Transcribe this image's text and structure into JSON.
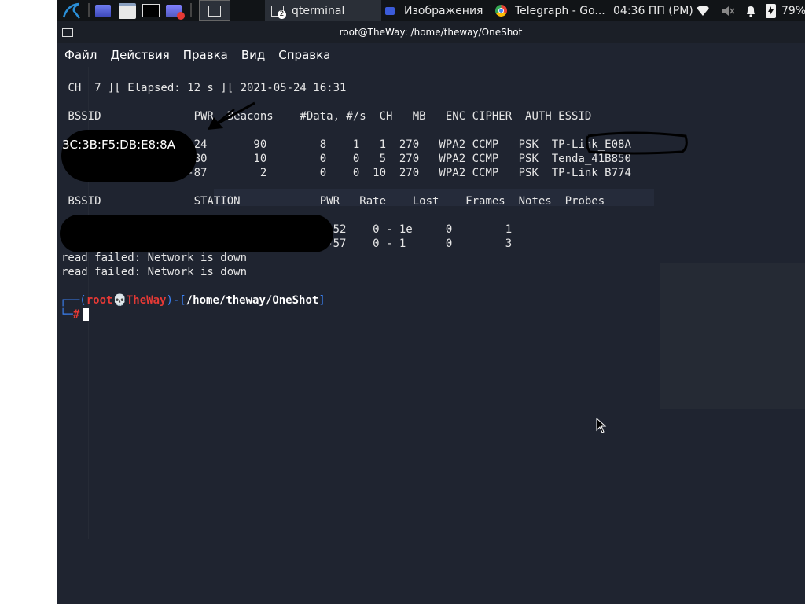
{
  "taskbar": {
    "apps": [
      {
        "label": "qterminal",
        "badge": "2"
      },
      {
        "label": "Изображения"
      },
      {
        "label": "Telegraph - Go..."
      }
    ],
    "clock": "04:36 ПП (PM)",
    "battery": "79%"
  },
  "window": {
    "title": "root@TheWay: /home/theway/OneShot",
    "menu": [
      "Файл",
      "Действия",
      "Правка",
      "Вид",
      "Справка"
    ]
  },
  "terminal": {
    "status_line": " CH  7 ][ Elapsed: 12 s ][ 2021-05-24 16:31",
    "ap_header": " BSSID              PWR  Beacons    #Data, #/s  CH   MB   ENC CIPHER  AUTH ESSID",
    "ap_rows": [
      "                   -24       90        8    1   1  270   WPA2 CCMP   PSK  TP-Link_E08A",
      "                   -80       10        0    0   5  270   WPA2 CCMP   PSK  Tenda_41B850",
      "                   -87        2        0    0  10  270   WPA2 CCMP   PSK  TP-Link_B774"
    ],
    "bssid_visible": "3C:3B:F5:DB:E8:8A",
    "station_header": " BSSID              STATION            PWR   Rate    Lost    Frames  Notes  Probes",
    "station_rows": [
      "                                        -52    0 - 1e     0        1",
      "                                        -57    0 - 1      0        3"
    ],
    "errors": [
      "read failed: Network is down",
      "read failed: Network is down"
    ],
    "prompt_user": "root",
    "prompt_host": "TheWay",
    "prompt_path": "/home/theway/OneShot",
    "prompt_symbol": "#"
  },
  "colors": {
    "terminal_bg": "#1f2430",
    "prompt_accent": "#3b82f6",
    "prompt_user": "#e53935"
  }
}
